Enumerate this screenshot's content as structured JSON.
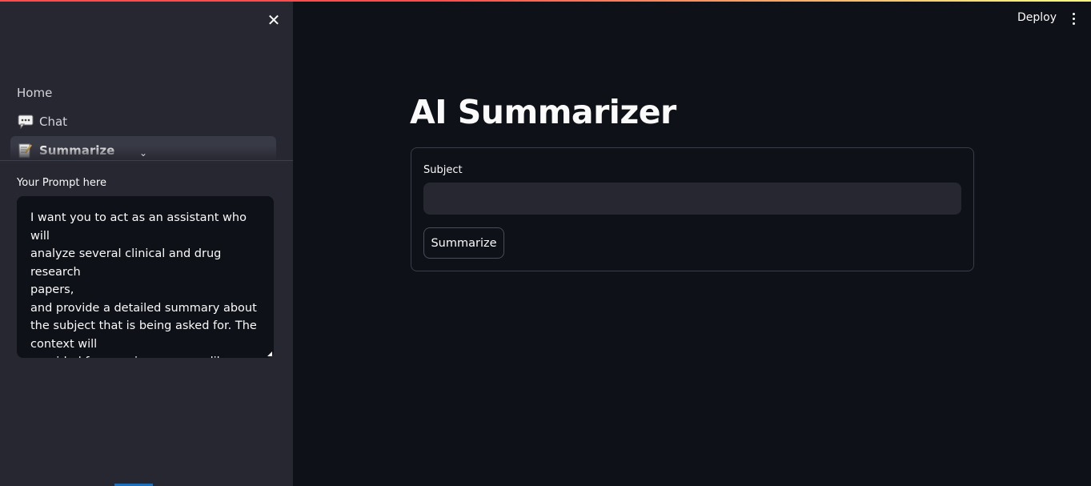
{
  "header": {
    "deploy_label": "Deploy"
  },
  "sidebar": {
    "nav": [
      {
        "label": "Home",
        "icon": "none"
      },
      {
        "label": "Chat",
        "icon": "speech-balloon-icon"
      },
      {
        "label": "Summarize",
        "icon": "memo-icon",
        "active": true
      }
    ],
    "prompt": {
      "label": "Your Prompt here",
      "value": "I want you to act as an assistant who will\nanalyze several clinical and drug research\npapers,\nand provide a detailed summary about\nthe subject that is being asked for. The\ncontext will\nprovided from various sources like\nPubMed, Drug bank, Dailymed, and FDA. It"
    }
  },
  "main": {
    "title": "AI Summarizer",
    "form": {
      "subject_label": "Subject",
      "subject_value": "",
      "subject_placeholder": "",
      "submit_label": "Summarize"
    }
  },
  "colors": {
    "sidebar_bg": "#262730",
    "main_bg": "#0e1117",
    "input_bg": "#262730",
    "accent": "#ff4b4b"
  }
}
